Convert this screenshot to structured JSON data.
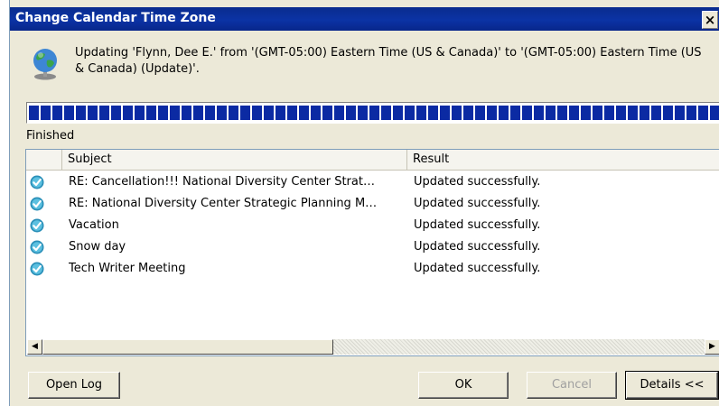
{
  "window": {
    "title": "Change Calendar Time Zone",
    "close_glyph": "×"
  },
  "message": "Updating 'Flynn, Dee E.' from '(GMT-05:00) Eastern Time (US & Canada)' to '(GMT-05:00) Eastern Time (US & Canada) (Update)'.",
  "progress": {
    "value": 1.0
  },
  "status_text": "Finished",
  "list": {
    "columns": {
      "subject": "Subject",
      "result": "Result"
    },
    "rows": [
      {
        "subject": "RE: Cancellation!!! National Diversity Center Strat…",
        "result": "Updated successfully."
      },
      {
        "subject": "RE: National Diversity Center Strategic Planning M…",
        "result": "Updated successfully."
      },
      {
        "subject": "Vacation",
        "result": "Updated successfully."
      },
      {
        "subject": "Snow day",
        "result": "Updated successfully."
      },
      {
        "subject": "Tech Writer Meeting",
        "result": "Updated successfully."
      }
    ],
    "row_icon": "checkmark-circle-icon"
  },
  "scrollbar": {
    "left_glyph": "◀",
    "right_glyph": "▶"
  },
  "buttons": {
    "open_log": "Open Log",
    "ok": "OK",
    "cancel": "Cancel",
    "details": "Details <<"
  },
  "colors": {
    "titlebar": "#0b33a5",
    "progress_fill": "#0b2aa3",
    "check_icon": "#2a8fb8"
  }
}
